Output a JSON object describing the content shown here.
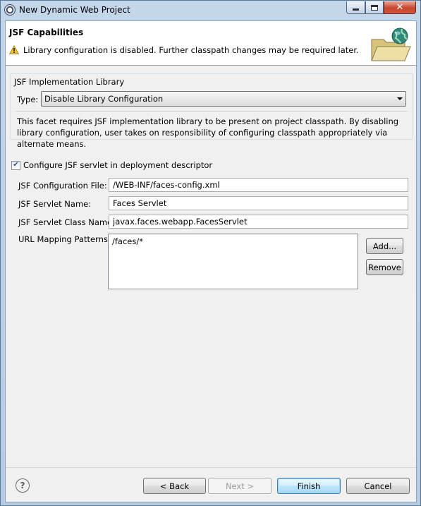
{
  "window": {
    "title": "New Dynamic Web Project",
    "minimize_icon": "minimize-icon",
    "maximize_icon": "maximize-icon",
    "close_glyph": "✕"
  },
  "banner": {
    "title": "JSF Capabilities",
    "message": "Library configuration is disabled. Further classpath changes may be required later.",
    "warning_icon": "warning-icon",
    "wizard_icon": "folder-globe-icon"
  },
  "library_group": {
    "legend": "JSF Implementation Library",
    "type_label": "Type:",
    "type_value": "Disable Library Configuration",
    "description": "This facet requires JSF implementation library to be present on project classpath. By disabling library configuration, user takes on responsibility of configuring classpath appropriately via alternate means."
  },
  "servlet": {
    "configure_label": "Configure JSF servlet in deployment descriptor",
    "configure_checked": true,
    "config_file_label": "JSF Configuration File:",
    "config_file_value": "/WEB-INF/faces-config.xml",
    "servlet_name_label": "JSF Servlet Name:",
    "servlet_name_value": "Faces Servlet",
    "servlet_class_label": "JSF Servlet Class Name:",
    "servlet_class_value": "javax.faces.webapp.FacesServlet",
    "url_mapping_label": "URL Mapping Patterns:",
    "url_patterns": [
      "/faces/*"
    ],
    "add_button": "Add...",
    "remove_button": "Remove"
  },
  "footer": {
    "help_glyph": "?",
    "back_button": "< Back",
    "next_button": "Next >",
    "finish_button": "Finish",
    "cancel_button": "Cancel"
  },
  "colors": {
    "title_bar": "#b9cde4",
    "default_button": "#3c7fb1",
    "warning": "#f2c230"
  }
}
